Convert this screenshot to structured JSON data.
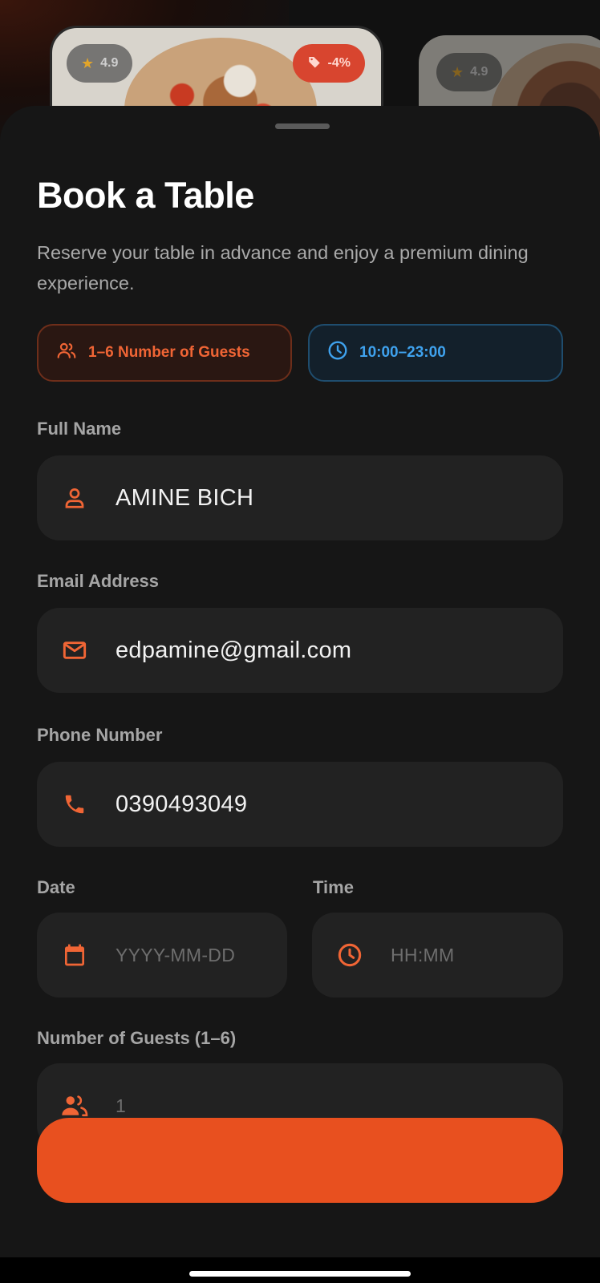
{
  "background_cards": [
    {
      "rating": "4.9",
      "discount": "-4%"
    },
    {
      "rating": "4.9"
    }
  ],
  "sheet": {
    "title": "Book a Table",
    "subtitle": "Reserve your table in advance and enjoy a premium dining experience.",
    "chips": {
      "guests": "1–6 Number of Guests",
      "hours": "10:00–23:00"
    }
  },
  "form": {
    "full_name": {
      "label": "Full Name",
      "value": "AMINE BICH",
      "icon": "person-icon"
    },
    "email": {
      "label": "Email Address",
      "value": "edpamine@gmail.com",
      "icon": "mail-icon"
    },
    "phone": {
      "label": "Phone Number",
      "value": "0390493049",
      "icon": "phone-icon"
    },
    "date": {
      "label": "Date",
      "placeholder": "YYYY-MM-DD",
      "icon": "calendar-icon"
    },
    "time": {
      "label": "Time",
      "placeholder": "HH:MM",
      "icon": "clock-icon"
    },
    "guests": {
      "label": "Number of Guests (1–6)",
      "placeholder": "1",
      "icon": "people-icon"
    }
  },
  "colors": {
    "accent": "#e8501f",
    "accent_text": "#f06535",
    "info": "#3fa2ee",
    "sheet_bg": "#161616",
    "field_bg": "#222222"
  }
}
